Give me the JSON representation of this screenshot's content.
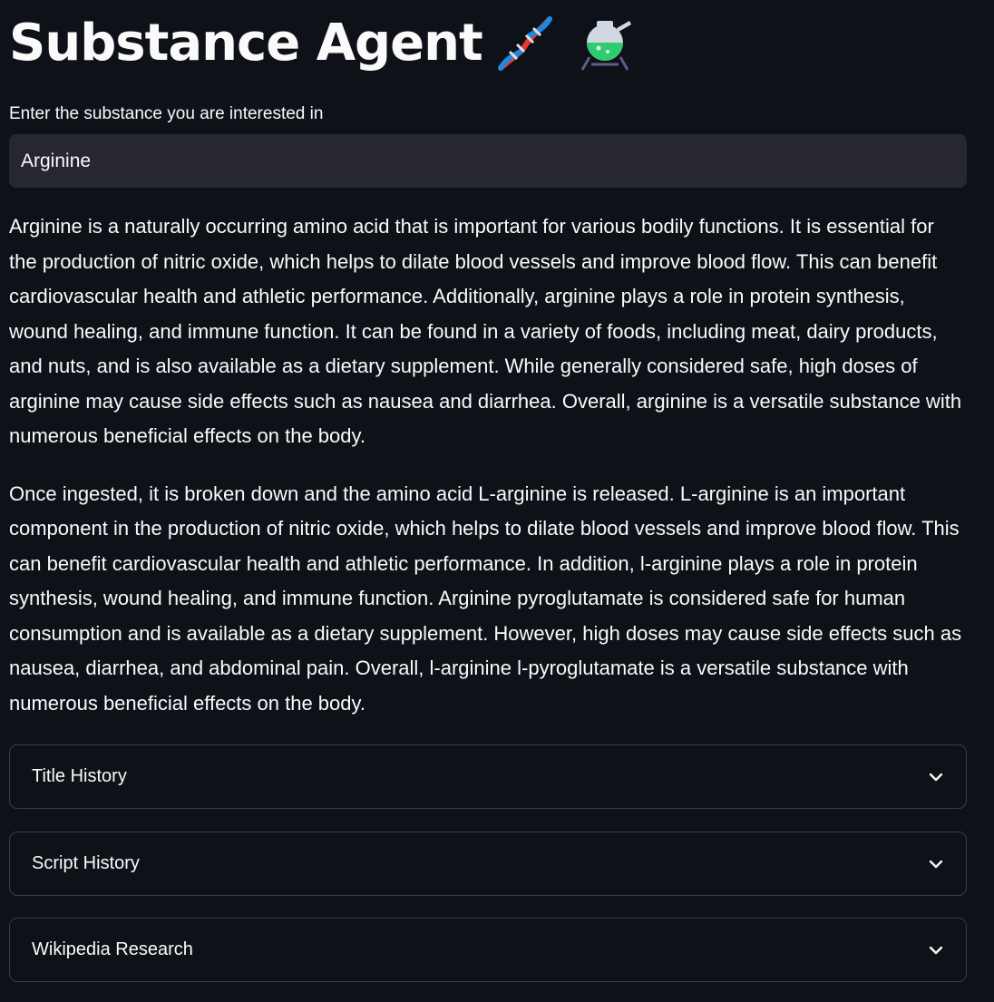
{
  "app": {
    "title": "Substance Agent",
    "title_icons": [
      "dna-icon",
      "flask-icon"
    ]
  },
  "input": {
    "label": "Enter the substance you are interested in",
    "value": "Arginine"
  },
  "content": {
    "paragraph1": "Arginine is a naturally occurring amino acid that is important for various bodily functions. It is essential for the production of nitric oxide, which helps to dilate blood vessels and improve blood flow. This can benefit cardiovascular health and athletic performance. Additionally, arginine plays a role in protein synthesis, wound healing, and immune function. It can be found in a variety of foods, including meat, dairy products, and nuts, and is also available as a dietary supplement. While generally considered safe, high doses of arginine may cause side effects such as nausea and diarrhea. Overall, arginine is a versatile substance with numerous beneficial effects on the body.",
    "paragraph2": "Once ingested, it is broken down and the amino acid L-arginine is released. L-arginine is an important component in the production of nitric oxide, which helps to dilate blood vessels and improve blood flow. This can benefit cardiovascular health and athletic performance. In addition, l-arginine plays a role in protein synthesis, wound healing, and immune function. Arginine pyroglutamate is considered safe for human consumption and is available as a dietary supplement. However, high doses may cause side effects such as nausea, diarrhea, and abdominal pain. Overall, l-arginine l-pyroglutamate is a versatile substance with numerous beneficial effects on the body."
  },
  "expanders": [
    {
      "label": "Title History",
      "icon": "chevron-down-icon"
    },
    {
      "label": "Script History",
      "icon": "chevron-down-icon"
    },
    {
      "label": "Wikipedia Research",
      "icon": "chevron-down-icon"
    }
  ],
  "colors": {
    "background": "#0e1117",
    "input_background": "#262730",
    "text": "#fafafa",
    "border": "#3a3d47"
  }
}
